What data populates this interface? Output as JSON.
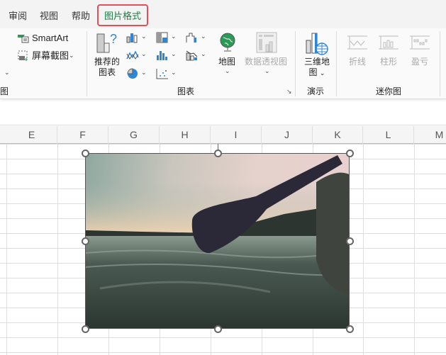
{
  "tabs": [
    {
      "label": "审阅"
    },
    {
      "label": "视图"
    },
    {
      "label": "帮助"
    },
    {
      "label": "图片格式",
      "active": true
    }
  ],
  "ribbon": {
    "smartart": "SmartArt",
    "screenshot": "屏幕截图",
    "left_group_label": "图",
    "recommended_charts": "推荐的图表",
    "recommended_charts_l1": "推荐的",
    "recommended_charts_l2": "图表",
    "map": "地图",
    "pivot_chart": "数据透视图",
    "charts_group_label": "图表",
    "map3d_l1": "三维地",
    "map3d_l2": "图",
    "tours_group_label": "演示",
    "sparkline_line": "折线",
    "sparkline_column": "柱形",
    "sparkline_winloss": "盈亏",
    "sparklines_group_label": "迷你图"
  },
  "columns": [
    "E",
    "F",
    "G",
    "H",
    "I",
    "J",
    "K",
    "L",
    "M"
  ],
  "colors": {
    "active_tab": "#1e7b45",
    "tab_highlight": "#e0505a",
    "chart_blue": "#2e86d6"
  }
}
